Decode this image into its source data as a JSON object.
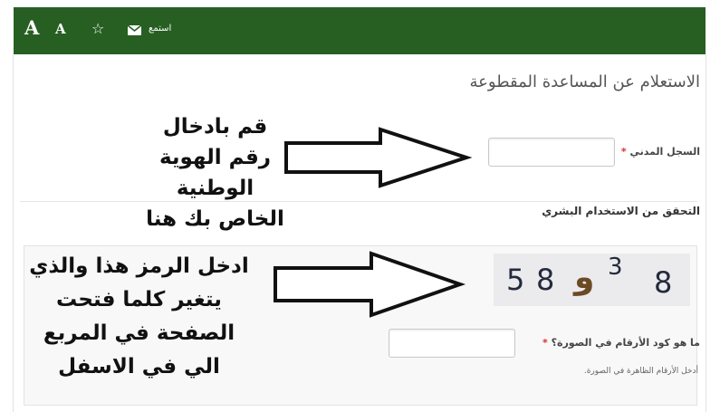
{
  "toolbar": {
    "font_large_label": "A",
    "font_small_label": "A",
    "favorite_glyph": "☆",
    "listen_label": "استمع",
    "bg_color": "#275f23"
  },
  "page": {
    "title": "الاستعلام عن المساعدة المقطوعة"
  },
  "form": {
    "civil_id_label": "السجل المدني",
    "required_mark": "*",
    "civil_id_value": "",
    "human_check_heading": "التحقق من الاستخدام البشري",
    "captcha_digits": [
      "5",
      "8",
      "و",
      "3",
      "8"
    ],
    "captcha_question_label": "ما هو كود الأرقام في الصورة؟",
    "captcha_answer_value": "",
    "captcha_hint": "أدخل الأرقام الظاهرة في الصورة."
  },
  "annotations": {
    "note1_lines": [
      "قم بادخال رقم الهوية",
      "الوطنية الخاص بك هنا"
    ],
    "note2_lines": [
      "ادخل الرمز هذا والذي",
      "يتغير كلما فتحت",
      "الصفحة في المربع",
      "الي في الاسفل"
    ]
  }
}
